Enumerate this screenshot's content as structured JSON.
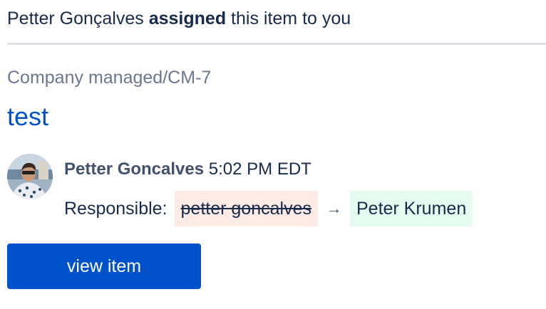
{
  "notification": {
    "actor": "Petter Gonçalves",
    "action": "assigned",
    "suffix": "this item to you"
  },
  "breadcrumb": "Company managed/CM-7",
  "item": {
    "title": "test"
  },
  "activity": {
    "author": "Petter Goncalves",
    "time": "5:02 PM EDT",
    "avatar_icon": "user-avatar",
    "change": {
      "field": "Responsible:",
      "old_value": "petter goncalves",
      "arrow": "→",
      "new_value": "Peter Krumen"
    }
  },
  "button": {
    "label": "view item"
  },
  "colors": {
    "link": "#0052cc",
    "button_bg": "#0052cc",
    "removed_bg": "#ffebe6",
    "added_bg": "#e3fcef",
    "muted_text": "#6b778c"
  }
}
